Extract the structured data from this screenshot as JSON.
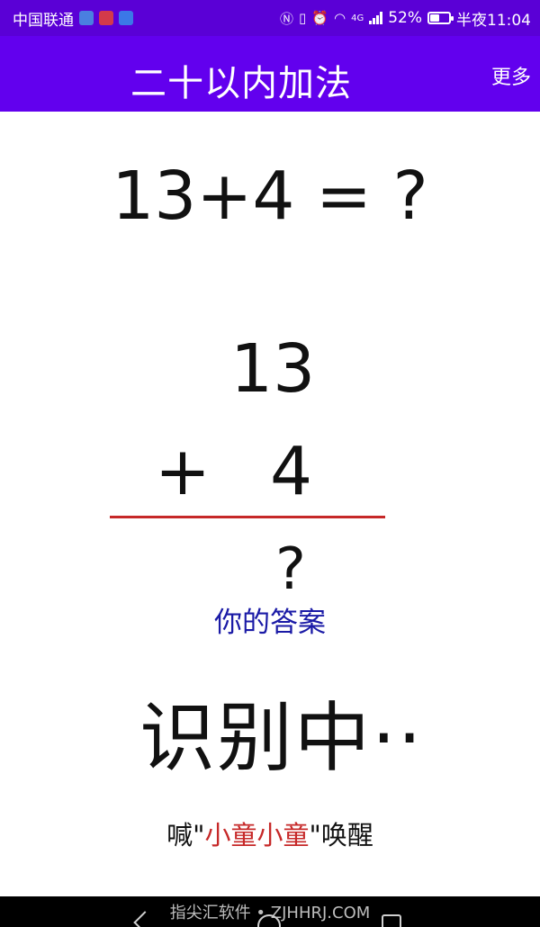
{
  "status_bar": {
    "carrier": "中国联通",
    "network": "4G",
    "battery_percent": "52%",
    "battery_level": 0.52,
    "time": "半夜11:04",
    "icons": [
      "shield-icon",
      "mic-icon",
      "camera-icon",
      "nfc-icon",
      "vibrate-icon",
      "alarm-icon",
      "wifi-icon",
      "signal-icon",
      "battery-icon"
    ]
  },
  "app_bar": {
    "title": "二十以内加法",
    "more_label": "更多"
  },
  "problem": {
    "equation": "13+4 = ?",
    "top_addend": "13",
    "operator": "+",
    "bottom_addend": "4",
    "answer_placeholder": "?",
    "answer_label": "你的答案"
  },
  "status": {
    "recognizing": "识别中··"
  },
  "hint": {
    "prefix": "喊\"",
    "wake_word": "小童小童",
    "suffix": "\"唤醒"
  },
  "footer": {
    "watermark": "指尖汇软件 • ZJHHRJ.COM"
  },
  "colors": {
    "status_bar": "#5a00d6",
    "app_bar": "#6200ee",
    "divider": "#c62828",
    "answer_label": "#1a1aa6",
    "wake_word": "#c62828"
  }
}
